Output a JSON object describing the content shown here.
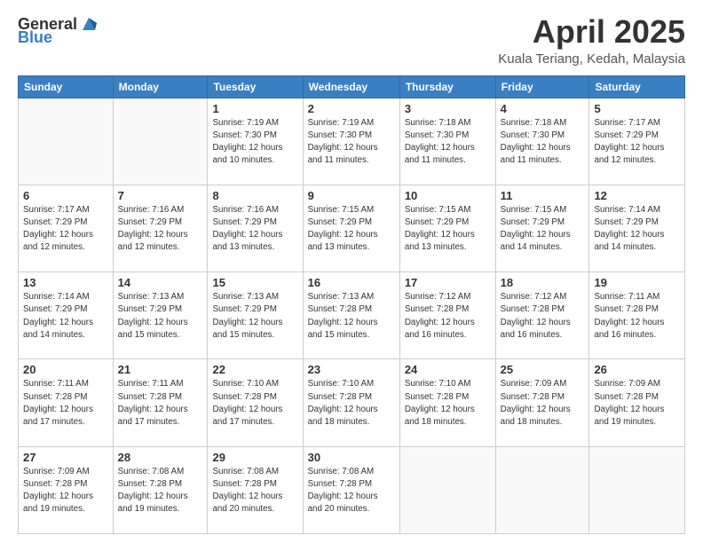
{
  "header": {
    "logo_general": "General",
    "logo_blue": "Blue",
    "month_title": "April 2025",
    "location": "Kuala Teriang, Kedah, Malaysia"
  },
  "weekdays": [
    "Sunday",
    "Monday",
    "Tuesday",
    "Wednesday",
    "Thursday",
    "Friday",
    "Saturday"
  ],
  "weeks": [
    [
      {
        "day": "",
        "info": ""
      },
      {
        "day": "",
        "info": ""
      },
      {
        "day": "1",
        "info": "Sunrise: 7:19 AM\nSunset: 7:30 PM\nDaylight: 12 hours\nand 10 minutes."
      },
      {
        "day": "2",
        "info": "Sunrise: 7:19 AM\nSunset: 7:30 PM\nDaylight: 12 hours\nand 11 minutes."
      },
      {
        "day": "3",
        "info": "Sunrise: 7:18 AM\nSunset: 7:30 PM\nDaylight: 12 hours\nand 11 minutes."
      },
      {
        "day": "4",
        "info": "Sunrise: 7:18 AM\nSunset: 7:30 PM\nDaylight: 12 hours\nand 11 minutes."
      },
      {
        "day": "5",
        "info": "Sunrise: 7:17 AM\nSunset: 7:29 PM\nDaylight: 12 hours\nand 12 minutes."
      }
    ],
    [
      {
        "day": "6",
        "info": "Sunrise: 7:17 AM\nSunset: 7:29 PM\nDaylight: 12 hours\nand 12 minutes."
      },
      {
        "day": "7",
        "info": "Sunrise: 7:16 AM\nSunset: 7:29 PM\nDaylight: 12 hours\nand 12 minutes."
      },
      {
        "day": "8",
        "info": "Sunrise: 7:16 AM\nSunset: 7:29 PM\nDaylight: 12 hours\nand 13 minutes."
      },
      {
        "day": "9",
        "info": "Sunrise: 7:15 AM\nSunset: 7:29 PM\nDaylight: 12 hours\nand 13 minutes."
      },
      {
        "day": "10",
        "info": "Sunrise: 7:15 AM\nSunset: 7:29 PM\nDaylight: 12 hours\nand 13 minutes."
      },
      {
        "day": "11",
        "info": "Sunrise: 7:15 AM\nSunset: 7:29 PM\nDaylight: 12 hours\nand 14 minutes."
      },
      {
        "day": "12",
        "info": "Sunrise: 7:14 AM\nSunset: 7:29 PM\nDaylight: 12 hours\nand 14 minutes."
      }
    ],
    [
      {
        "day": "13",
        "info": "Sunrise: 7:14 AM\nSunset: 7:29 PM\nDaylight: 12 hours\nand 14 minutes."
      },
      {
        "day": "14",
        "info": "Sunrise: 7:13 AM\nSunset: 7:29 PM\nDaylight: 12 hours\nand 15 minutes."
      },
      {
        "day": "15",
        "info": "Sunrise: 7:13 AM\nSunset: 7:29 PM\nDaylight: 12 hours\nand 15 minutes."
      },
      {
        "day": "16",
        "info": "Sunrise: 7:13 AM\nSunset: 7:28 PM\nDaylight: 12 hours\nand 15 minutes."
      },
      {
        "day": "17",
        "info": "Sunrise: 7:12 AM\nSunset: 7:28 PM\nDaylight: 12 hours\nand 16 minutes."
      },
      {
        "day": "18",
        "info": "Sunrise: 7:12 AM\nSunset: 7:28 PM\nDaylight: 12 hours\nand 16 minutes."
      },
      {
        "day": "19",
        "info": "Sunrise: 7:11 AM\nSunset: 7:28 PM\nDaylight: 12 hours\nand 16 minutes."
      }
    ],
    [
      {
        "day": "20",
        "info": "Sunrise: 7:11 AM\nSunset: 7:28 PM\nDaylight: 12 hours\nand 17 minutes."
      },
      {
        "day": "21",
        "info": "Sunrise: 7:11 AM\nSunset: 7:28 PM\nDaylight: 12 hours\nand 17 minutes."
      },
      {
        "day": "22",
        "info": "Sunrise: 7:10 AM\nSunset: 7:28 PM\nDaylight: 12 hours\nand 17 minutes."
      },
      {
        "day": "23",
        "info": "Sunrise: 7:10 AM\nSunset: 7:28 PM\nDaylight: 12 hours\nand 18 minutes."
      },
      {
        "day": "24",
        "info": "Sunrise: 7:10 AM\nSunset: 7:28 PM\nDaylight: 12 hours\nand 18 minutes."
      },
      {
        "day": "25",
        "info": "Sunrise: 7:09 AM\nSunset: 7:28 PM\nDaylight: 12 hours\nand 18 minutes."
      },
      {
        "day": "26",
        "info": "Sunrise: 7:09 AM\nSunset: 7:28 PM\nDaylight: 12 hours\nand 19 minutes."
      }
    ],
    [
      {
        "day": "27",
        "info": "Sunrise: 7:09 AM\nSunset: 7:28 PM\nDaylight: 12 hours\nand 19 minutes."
      },
      {
        "day": "28",
        "info": "Sunrise: 7:08 AM\nSunset: 7:28 PM\nDaylight: 12 hours\nand 19 minutes."
      },
      {
        "day": "29",
        "info": "Sunrise: 7:08 AM\nSunset: 7:28 PM\nDaylight: 12 hours\nand 20 minutes."
      },
      {
        "day": "30",
        "info": "Sunrise: 7:08 AM\nSunset: 7:28 PM\nDaylight: 12 hours\nand 20 minutes."
      },
      {
        "day": "",
        "info": ""
      },
      {
        "day": "",
        "info": ""
      },
      {
        "day": "",
        "info": ""
      }
    ]
  ]
}
